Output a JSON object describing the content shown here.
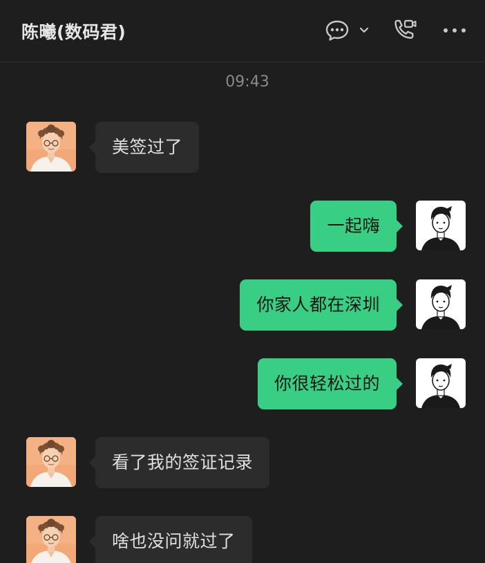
{
  "header": {
    "title": "陈曦(数码君)",
    "icons": {
      "chat": "chat-bubble-icon",
      "dropdown": "chevron-down-icon",
      "call": "phone-video-icon",
      "more": "more-dots-icon"
    }
  },
  "timestamp": "09:43",
  "messages": [
    {
      "direction": "in",
      "text": "美签过了"
    },
    {
      "direction": "out",
      "text": "一起嗨"
    },
    {
      "direction": "out",
      "text": "你家人都在深圳"
    },
    {
      "direction": "out",
      "text": "你很轻松过的"
    },
    {
      "direction": "in",
      "text": "看了我的签证记录"
    },
    {
      "direction": "in",
      "text": "啥也没问就过了"
    }
  ],
  "colors": {
    "background": "#1e1e1e",
    "incoming_bubble": "#2c2c2c",
    "outgoing_bubble": "#38cf84",
    "title_text": "#e6e6e6",
    "timestamp_text": "#8a8a8a"
  }
}
